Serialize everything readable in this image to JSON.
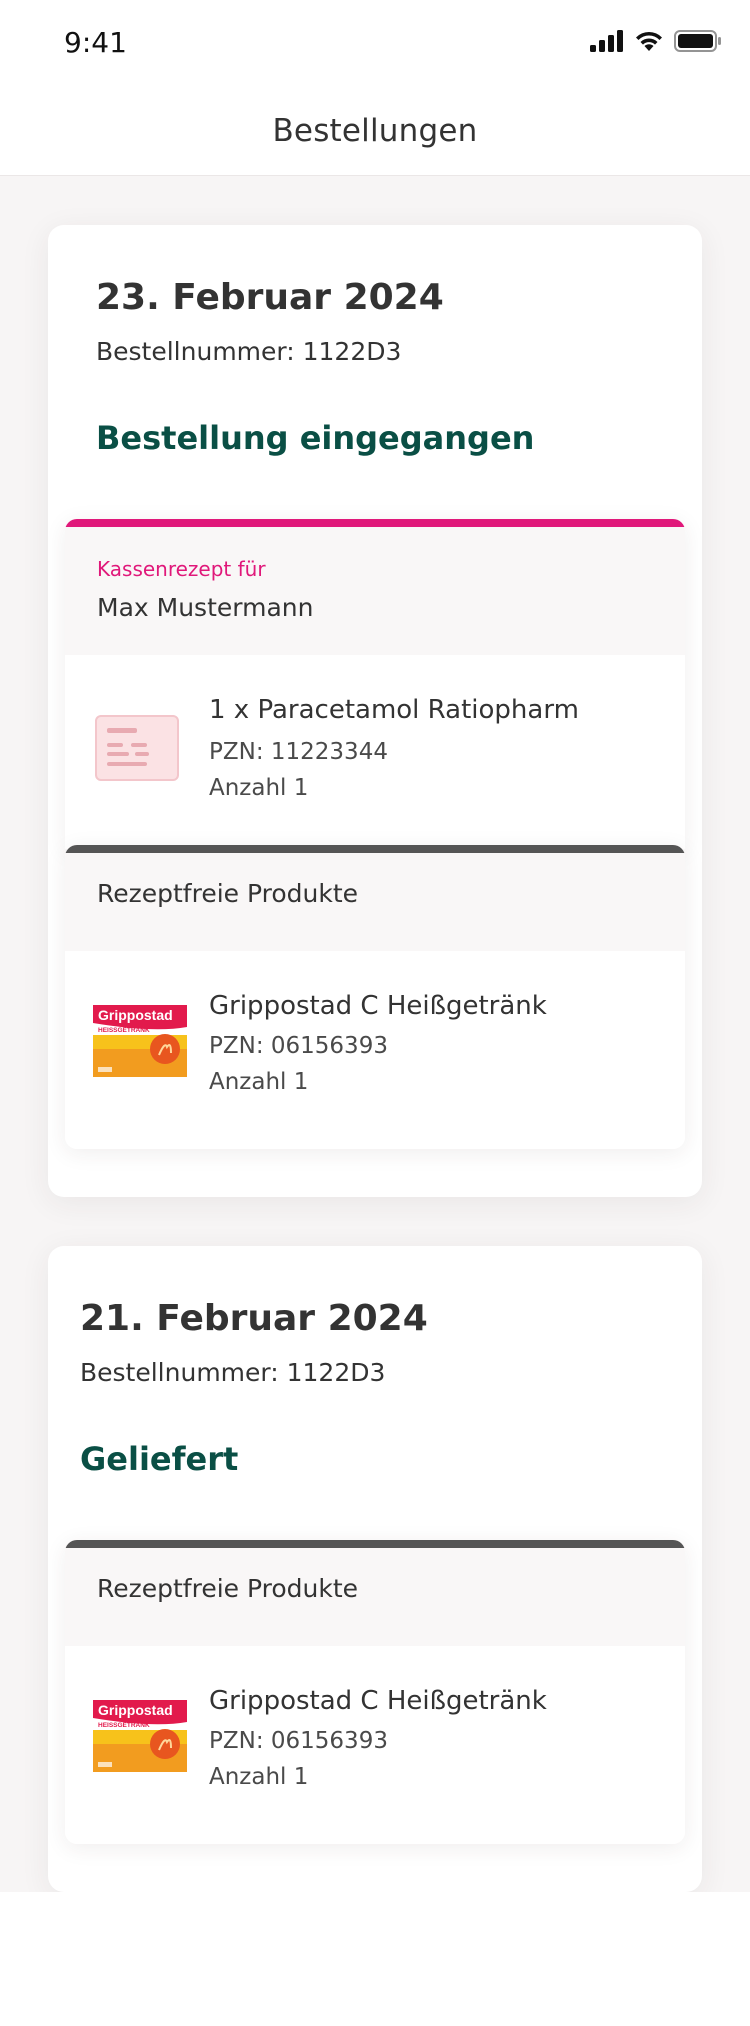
{
  "status_bar": {
    "time": "9:41",
    "icons": [
      "signal-icon",
      "wifi-icon",
      "battery-icon"
    ]
  },
  "nav": {
    "title": "Bestellungen"
  },
  "orders": [
    {
      "date": "23. Februar 2024",
      "number": "Bestellnummer: 1122D3",
      "status": "Bestellung eingegangen",
      "groups": [
        {
          "type": "prescription",
          "subtitle": "Kassenrezept für",
          "name": "Max Mustermann",
          "accent": "#e0187a",
          "items": [
            {
              "name": "1 x Paracetamol Ratiopharm",
              "pzn": "PZN: 11223344",
              "qty": "Anzahl 1",
              "thumb": "prescription-icon"
            }
          ]
        },
        {
          "type": "otc",
          "title": "Rezeptfreie Produkte",
          "accent": "#555555",
          "items": [
            {
              "name": "Grippostad C Heißgetränk",
              "pzn": "PZN: 06156393",
              "qty": "Anzahl 1",
              "thumb": "grippostad-box",
              "brand": "Grippostad",
              "brand_sub": "HEISSGETRÄNK"
            }
          ]
        }
      ]
    },
    {
      "date": "21. Februar 2024",
      "number": "Bestellnummer: 1122D3",
      "status": "Geliefert",
      "groups": [
        {
          "type": "otc",
          "title": "Rezeptfreie Produkte",
          "accent": "#555555",
          "items": [
            {
              "name": "Grippostad C Heißgetränk",
              "pzn": "PZN: 06156393",
              "qty": "Anzahl 1",
              "thumb": "grippostad-box",
              "brand": "Grippostad",
              "brand_sub": "HEISSGETRÄNK"
            }
          ]
        }
      ]
    }
  ],
  "colors": {
    "status_green": "#0a4f45",
    "prescription_pink": "#e0187a",
    "otc_bar": "#555555"
  }
}
